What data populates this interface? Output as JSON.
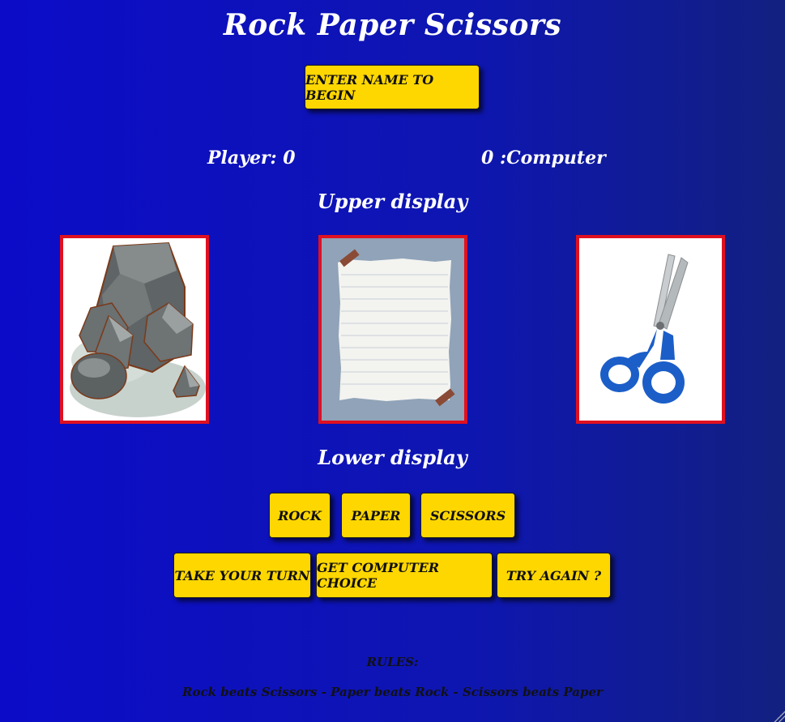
{
  "game": {
    "title": "Rock Paper Scissors"
  },
  "header": {
    "start_button": "ENTER NAME TO BEGIN"
  },
  "scoreboard": {
    "player_text": "Player: 0",
    "computer_text": "0 :Computer"
  },
  "displays": {
    "upper": "Upper display",
    "lower": "Lower display"
  },
  "choices": [
    {
      "name": "rock",
      "label": "ROCK"
    },
    {
      "name": "paper",
      "label": "PAPER"
    },
    {
      "name": "scissors",
      "label": "SCISSORS"
    }
  ],
  "actions": {
    "take_turn": "TAKE YOUR TURN",
    "computer_choice": "GET COMPUTER CHOICE",
    "try_again": "TRY AGAIN ?"
  },
  "rules": {
    "heading": "RULES:",
    "text": "Rock beats Scissors - Paper beats Rock - Scissors beats Paper"
  },
  "colors": {
    "background": "#0c0cc8",
    "button": "#ffd700",
    "card_border": "#e01020",
    "text": "#ffffff"
  },
  "icons": [
    "rock-image",
    "paper-image",
    "scissors-image"
  ]
}
